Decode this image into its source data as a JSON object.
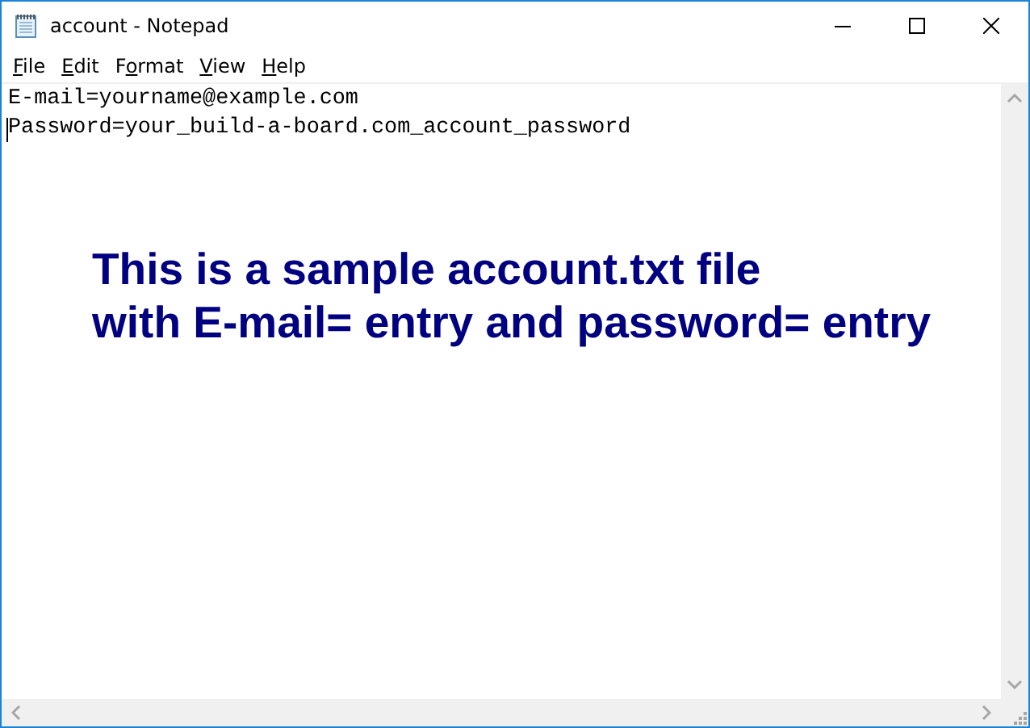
{
  "window": {
    "title": "account - Notepad"
  },
  "menu": [
    {
      "parts": [
        {
          "text": "F",
          "underlined": true
        },
        {
          "text": "ile",
          "underlined": false
        }
      ]
    },
    {
      "parts": [
        {
          "text": "E",
          "underlined": true
        },
        {
          "text": "dit",
          "underlined": false
        }
      ]
    },
    {
      "parts": [
        {
          "text": "F",
          "underlined": false
        },
        {
          "text": "o",
          "underlined": true
        },
        {
          "text": "rmat",
          "underlined": false
        }
      ]
    },
    {
      "parts": [
        {
          "text": "V",
          "underlined": true
        },
        {
          "text": "iew",
          "underlined": false
        }
      ]
    },
    {
      "parts": [
        {
          "text": "H",
          "underlined": true
        },
        {
          "text": "elp",
          "underlined": false
        }
      ]
    }
  ],
  "editor": {
    "lines": [
      "E-mail=yourname@example.com",
      "Password=your_build-a-board.com_account_password"
    ]
  },
  "annotation": {
    "lines": [
      "This is a sample account.txt file",
      "with E-mail= entry and password= entry"
    ]
  }
}
